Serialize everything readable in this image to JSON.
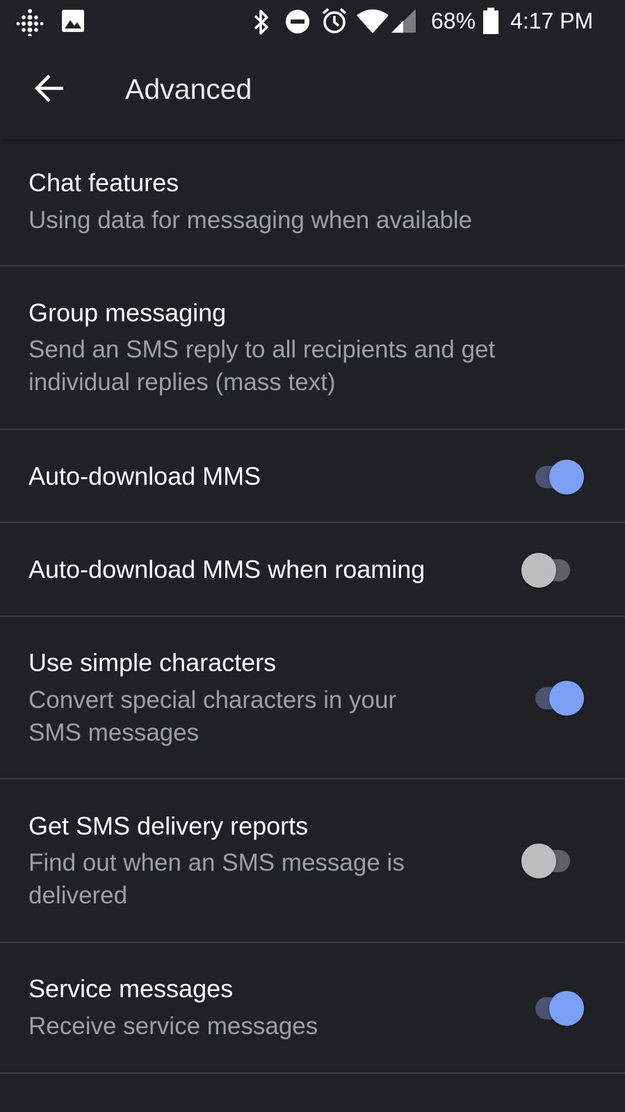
{
  "status_bar": {
    "icons_left": [
      "fitbit-icon",
      "image-notification-icon"
    ],
    "icons_right": [
      "bluetooth-icon",
      "do-not-disturb-icon",
      "alarm-icon",
      "wifi-icon",
      "cellular-signal-icon",
      "battery-icon"
    ],
    "battery_percent": "68%",
    "time": "4:17 PM"
  },
  "app_bar": {
    "back_icon": "arrow-back-icon",
    "title": "Advanced"
  },
  "settings": [
    {
      "title": "Chat features",
      "description": "Using data for messaging when available"
    },
    {
      "title": "Group messaging",
      "description": "Send an SMS reply to all recipients and get\nindividual replies (mass text)"
    },
    {
      "title": "Auto-download MMS",
      "toggle": true
    },
    {
      "title": "Auto-download MMS when roaming",
      "toggle": false
    },
    {
      "title": "Use simple characters",
      "description": "Convert special characters in your\nSMS messages",
      "toggle": true
    },
    {
      "title": "Get SMS delivery reports",
      "description": "Find out when an SMS message is\ndelivered",
      "toggle": false
    },
    {
      "title": "Service messages",
      "description": "Receive service messages",
      "toggle": true
    }
  ],
  "colors": {
    "background": "#202124",
    "divider": "#3c3d40",
    "secondary_text": "#9aa0a6",
    "toggle_on_thumb": "#7ba1f5",
    "toggle_on_track": "#4a5470",
    "toggle_off_thumb": "#bdbdbd",
    "toggle_off_track": "#5f6063"
  }
}
